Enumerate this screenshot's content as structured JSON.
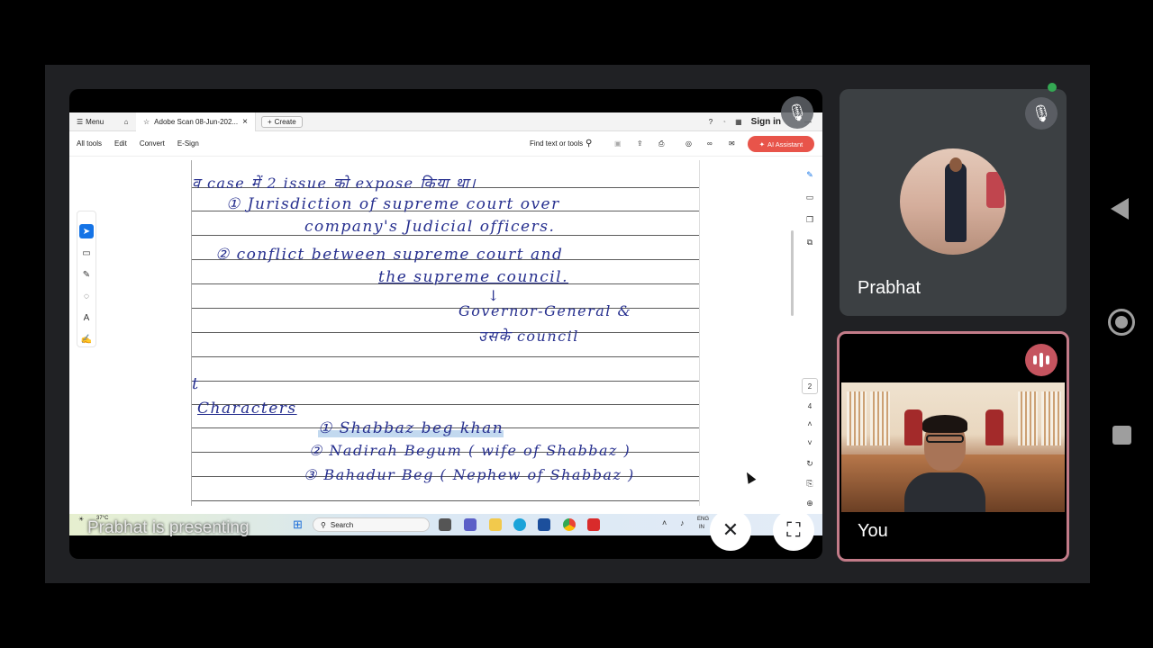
{
  "presentation": {
    "presenting_label": "Prabhat is presenting",
    "acrobat": {
      "menu_label": "Menu",
      "tab_title": "Adobe Scan 08-Jun-202...",
      "create_label": "Create",
      "sign_in_label": "Sign in",
      "toolbar": {
        "all_tools": "All tools",
        "edit": "Edit",
        "convert": "Convert",
        "esign": "E-Sign",
        "find_label": "Find text or tools",
        "ai_assistant": "AI Assistant"
      },
      "page_numbers": [
        "2",
        "4"
      ],
      "handwritten_lines": [
        "व case में  2  issue को expose किया था।",
        "①  Jurisdiction  of  supreme  court  over",
        "company's  Judicial  officers.",
        "②  conflict  between  supreme  court  and",
        "the  supreme  council.",
        "↓",
        "Governor-General  &",
        "उसके  council",
        "t",
        "Characters",
        "①  Shabbaz  beg  khan",
        "②  Nadirah  Begum  ( wife  of  Shabbaz )",
        "③  Bahadur  Beg  ( Nephew  of  Shabbaz )"
      ]
    },
    "taskbar": {
      "weather_temp": "37°C",
      "search_label": "Search",
      "lang_top": "ENG",
      "lang_bottom": "IN"
    }
  },
  "participants": [
    {
      "name": "Prabhat",
      "mic": "muted"
    },
    {
      "name": "You",
      "mic": "speaking"
    }
  ],
  "colors": {
    "tile_bg": "#3c4043",
    "speaking_border": "#c27b88",
    "speaking_badge": "#c5545f",
    "ai_button": "#e8544a",
    "active_tool": "#1473e6",
    "handwriting_ink": "#27308f"
  }
}
